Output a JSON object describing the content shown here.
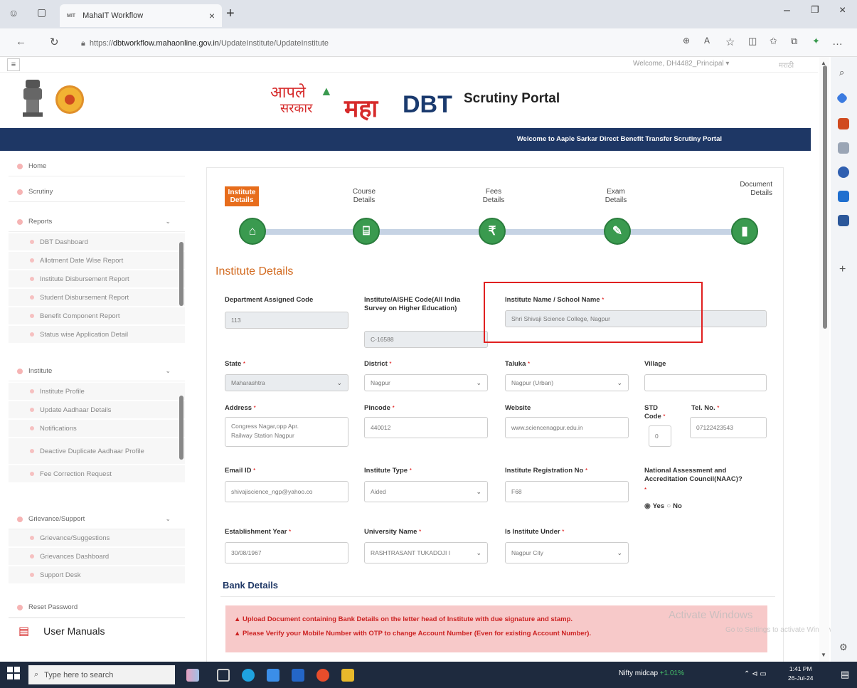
{
  "browser": {
    "tab_title": "MahaIT Workflow",
    "tab_favicon": "MIT",
    "url_prefix": "https://",
    "url_domain": "dbtworkflow.mahaonline.gov.in",
    "url_path": "/UpdateInstitute/UpdateInstitute"
  },
  "header": {
    "welcome_user": "Welcome, DH4482_Principal",
    "lang_link": "मराठी",
    "logo_aaple": "आपले",
    "logo_sarkar": "सरकार",
    "logo_maha": "महा",
    "logo_dbt": "DBT",
    "portal_title": "Scrutiny Portal",
    "banner": "Welcome to Aaple Sarkar Direct Benefit Transfer Scrutiny Portal"
  },
  "sidebar": {
    "home": "Home",
    "scrutiny": "Scrutiny",
    "reports": "Reports",
    "reports_items": [
      "DBT Dashboard",
      "Allotment Date Wise Report",
      "Institute Disbursement Report",
      "Student Disbursement Report",
      "Benefit Component Report",
      "Status wise Application Detail"
    ],
    "institute": "Institute",
    "institute_items": [
      "Institute Profile",
      "Update Aadhaar Details",
      "Notifications",
      "Deactive Duplicate Aadhaar Profile",
      "Fee Correction Request"
    ],
    "grievance": "Grievance/Support",
    "grievance_items": [
      "Grievance/Suggestions",
      "Grievances Dashboard",
      "Support Desk"
    ],
    "reset_password": "Reset Password",
    "user_manuals": "User Manuals"
  },
  "steps": {
    "institute": "Institute Details",
    "course": "Course Details",
    "fees": "Fees Details",
    "exam": "Exam Details",
    "document": "Document Details"
  },
  "section_title": "Institute Details",
  "form": {
    "dept_code_label": "Department Assigned Code",
    "dept_code_value": "113",
    "aishe_label": "Institute/AISHE Code(All India Survey on Higher Education)",
    "aishe_value": "C-16588",
    "inst_name_label": "Institute Name / School Name",
    "inst_name_value": "Shri Shivaji Science College, Nagpur",
    "state_label": "State",
    "state_value": "Maharashtra",
    "district_label": "District",
    "district_value": "Nagpur",
    "taluka_label": "Taluka",
    "taluka_value": "Nagpur (Urban)",
    "village_label": "Village",
    "village_value": "",
    "address_label": "Address",
    "address_line1": "Congress Nagar,opp Apr.",
    "address_line2": "Railway Station Nagpur",
    "pincode_label": "Pincode",
    "pincode_value": "440012",
    "website_label": "Website",
    "website_value": "www.sciencenagpur.edu.in",
    "std_label": "STD Code",
    "std_value": "0",
    "tel_label": "Tel. No.",
    "tel_value": "07122423543",
    "email_label": "Email ID",
    "email_value": "shivajiscience_ngp@yahoo.co",
    "inst_type_label": "Institute Type",
    "inst_type_value": "Aided",
    "inst_reg_label": "Institute Registration No",
    "inst_reg_value": "F68",
    "naac_label": "National Assessment and Accreditation Council(NAAC)?",
    "naac_yes": "Yes",
    "naac_no": "No",
    "estab_label": "Establishment Year",
    "estab_value": "30/08/1967",
    "univ_label": "University Name",
    "univ_value": "RASHTRASANT TUKADOJI I",
    "under_label": "Is Institute Under",
    "under_value": "Nagpur City"
  },
  "bank": {
    "header": "Bank Details",
    "alert1": "Upload Document containing Bank Details on the letter head of Institute with due signature and stamp.",
    "alert2": "Please Verify your Mobile Number with OTP to change Account Number (Even for existing Account Number)."
  },
  "watermark": {
    "line1": "Activate Windows",
    "line2": "Go to Settings to activate Windows."
  },
  "taskbar": {
    "search_placeholder": "Type here to search",
    "ticker_name": "Nifty midcap",
    "ticker_change": "+1.01%",
    "time": "1:41 PM",
    "date": "26-Jul-24"
  },
  "colors": {
    "brand_blue": "#1e3765",
    "accent_orange": "#e76d1c",
    "step_green": "#3a9a4f",
    "alert_bg": "#f7c9c9"
  }
}
